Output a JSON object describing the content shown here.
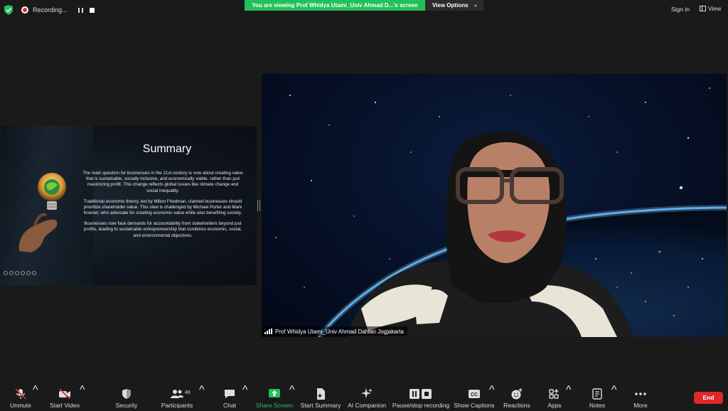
{
  "topbar": {
    "recording_label": "Recording...",
    "banner_text": "You are viewing Prof Whidya Utami_Univ Ahmad D...'s screen",
    "view_options_label": "View Options",
    "signin_label": "Sign in",
    "view_label": "View",
    "colors": {
      "banner": "#22c05a",
      "record": "#e02828",
      "shield": "#22c05a"
    }
  },
  "slide": {
    "title": "Summary",
    "paragraphs": [
      "The main question for businesses in the 21st century is now about creating value that is sustainable, socially inclusive, and economically viable, rather than just maximizing profit. This change reflects global issues like climate change and social inequality.",
      "Traditional economic theory, led by Milton Friedman, claimed businesses should prioritize shareholder value. This view is challenged by Michael Porter and Mark Kramer, who advocate for creating economic value while also benefiting society.",
      "Businesses now face demands for accountability from stakeholders beyond just profits, leading to sustainable entrepreneurship that combines economic, social, and environmental objectives."
    ]
  },
  "video": {
    "participant_name": "Prof Whidya Utami_Univ Ahmad Dahlan Jogjakarta"
  },
  "toolbar": {
    "items": [
      {
        "label": "Unmute",
        "icon": "mic-muted-icon"
      },
      {
        "label": "Start Video",
        "icon": "video-off-icon"
      },
      {
        "label": "Security",
        "icon": "shield-icon"
      },
      {
        "label": "Participants",
        "icon": "participants-icon",
        "count": "46"
      },
      {
        "label": "Chat",
        "icon": "chat-icon"
      },
      {
        "label": "Share Screen",
        "icon": "share-screen-icon"
      },
      {
        "label": "Start Summary",
        "icon": "summary-icon"
      },
      {
        "label": "AI Companion",
        "icon": "sparkle-icon"
      },
      {
        "label": "Pause/stop recording",
        "icon": "pause-stop-icon"
      },
      {
        "label": "Show Captions",
        "icon": "captions-icon"
      },
      {
        "label": "Reactions",
        "icon": "reactions-icon"
      },
      {
        "label": "Apps",
        "icon": "apps-icon"
      },
      {
        "label": "Notes",
        "icon": "notes-icon"
      },
      {
        "label": "More",
        "icon": "more-icon"
      }
    ],
    "end_label": "End",
    "colors": {
      "share": "#22c05a",
      "end": "#e02828",
      "muted": "#e02828"
    }
  }
}
